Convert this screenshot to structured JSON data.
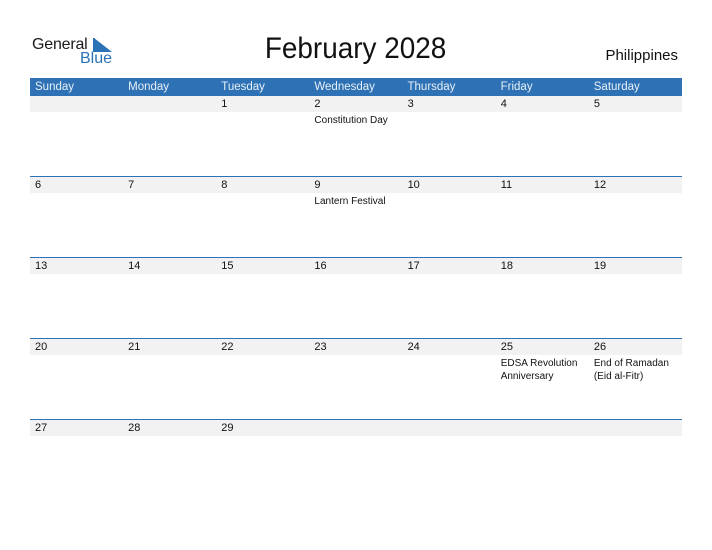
{
  "logo": {
    "text_general": "General",
    "text_blue": "Blue",
    "icon": "triangle-flag-icon"
  },
  "title": "February 2028",
  "country": "Philippines",
  "colors": {
    "accent": "#2e72b5",
    "strip": "#f2f2f2",
    "logo_blue": "#2b73b6"
  },
  "weekdays": [
    "Sunday",
    "Monday",
    "Tuesday",
    "Wednesday",
    "Thursday",
    "Friday",
    "Saturday"
  ],
  "weeks": [
    {
      "days": [
        {
          "num": "",
          "ev": ""
        },
        {
          "num": "",
          "ev": ""
        },
        {
          "num": "1",
          "ev": ""
        },
        {
          "num": "2",
          "ev": "Constitution Day"
        },
        {
          "num": "3",
          "ev": ""
        },
        {
          "num": "4",
          "ev": ""
        },
        {
          "num": "5",
          "ev": ""
        }
      ]
    },
    {
      "days": [
        {
          "num": "6",
          "ev": ""
        },
        {
          "num": "7",
          "ev": ""
        },
        {
          "num": "8",
          "ev": ""
        },
        {
          "num": "9",
          "ev": "Lantern Festival"
        },
        {
          "num": "10",
          "ev": ""
        },
        {
          "num": "11",
          "ev": ""
        },
        {
          "num": "12",
          "ev": ""
        }
      ]
    },
    {
      "days": [
        {
          "num": "13",
          "ev": ""
        },
        {
          "num": "14",
          "ev": ""
        },
        {
          "num": "15",
          "ev": ""
        },
        {
          "num": "16",
          "ev": ""
        },
        {
          "num": "17",
          "ev": ""
        },
        {
          "num": "18",
          "ev": ""
        },
        {
          "num": "19",
          "ev": ""
        }
      ]
    },
    {
      "days": [
        {
          "num": "20",
          "ev": ""
        },
        {
          "num": "21",
          "ev": ""
        },
        {
          "num": "22",
          "ev": ""
        },
        {
          "num": "23",
          "ev": ""
        },
        {
          "num": "24",
          "ev": ""
        },
        {
          "num": "25",
          "ev": "EDSA Revolution Anniversary"
        },
        {
          "num": "26",
          "ev": "End of Ramadan (Eid al-Fitr)"
        }
      ]
    },
    {
      "days": [
        {
          "num": "27",
          "ev": ""
        },
        {
          "num": "28",
          "ev": ""
        },
        {
          "num": "29",
          "ev": ""
        },
        {
          "num": "",
          "ev": ""
        },
        {
          "num": "",
          "ev": ""
        },
        {
          "num": "",
          "ev": ""
        },
        {
          "num": "",
          "ev": ""
        }
      ]
    }
  ]
}
